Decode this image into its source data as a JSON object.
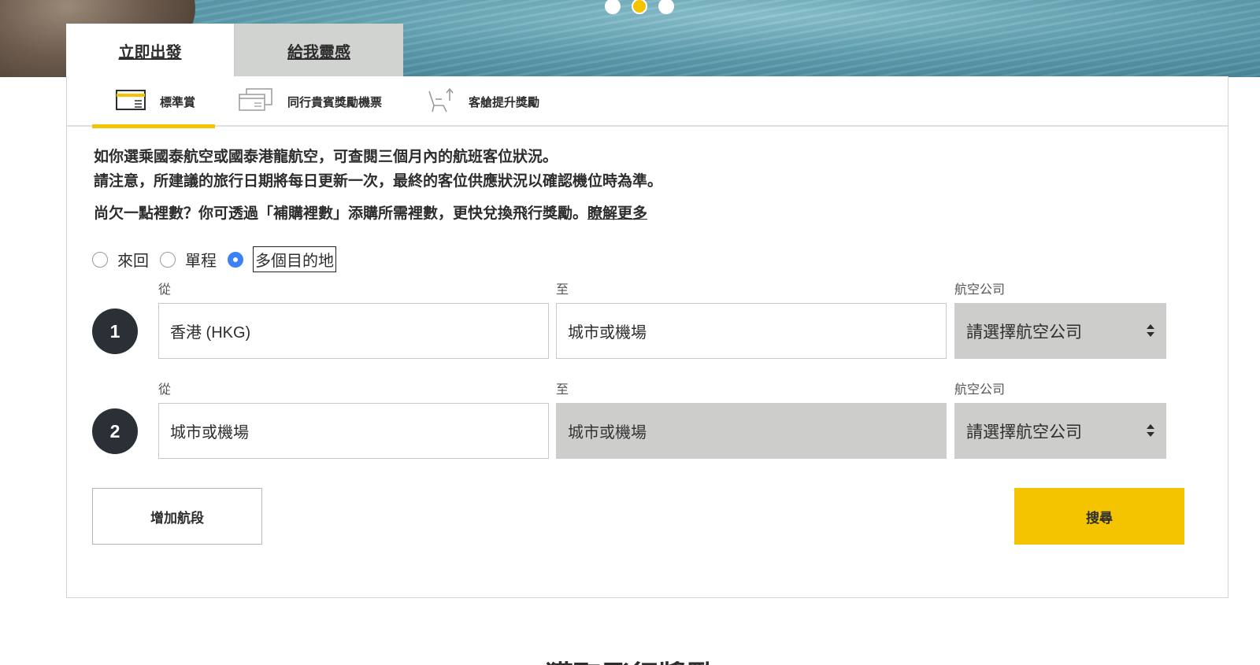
{
  "hero": {
    "dots": [
      false,
      true,
      false
    ]
  },
  "main_tabs": [
    {
      "label": "立即出發",
      "active": true
    },
    {
      "label": "給我靈感",
      "active": false
    }
  ],
  "sub_tabs": [
    {
      "label": "標準賞",
      "icon": "standard-award-icon",
      "active": true
    },
    {
      "label": "同行貴賓獎勵機票",
      "icon": "companion-ticket-icon",
      "active": false
    },
    {
      "label": "客艙提升獎勵",
      "icon": "seat-upgrade-icon",
      "active": false
    }
  ],
  "info": {
    "line1": "如你選乘國泰航空或國泰港龍航空，可查閱三個月內的航班客位狀況。",
    "line2": "請注意，所建議的旅行日期將每日更新一次，最終的客位供應狀況以確認機位時為準。",
    "more_text": "尚欠一點裡數？你可透過「補購裡數」添購所需裡數，更快兌換飛行獎勵。",
    "more_link": "瞭解更多"
  },
  "trip_type": {
    "options": [
      {
        "label": "來回",
        "checked": false
      },
      {
        "label": "單程",
        "checked": false
      },
      {
        "label": "多個目的地",
        "checked": true
      }
    ]
  },
  "segments": [
    {
      "number": "1",
      "from_label": "從",
      "from_value": "香港 (HKG)",
      "to_label": "至",
      "to_value": "城市或機場",
      "airline_label": "航空公司",
      "airline_value": "請選擇航空公司"
    },
    {
      "number": "2",
      "from_label": "從",
      "from_value": "城市或機場",
      "to_label": "至",
      "to_value": "城市或機場",
      "airline_label": "航空公司",
      "airline_value": "請選擇航空公司"
    }
  ],
  "buttons": {
    "add_segment": "增加航段",
    "search": "搜尋"
  },
  "colors": {
    "accent": "#f5c400",
    "dark": "#2b2f36",
    "disabled_bg": "#cdcecc"
  },
  "bottom_heading": "獲取飛行獎勵"
}
